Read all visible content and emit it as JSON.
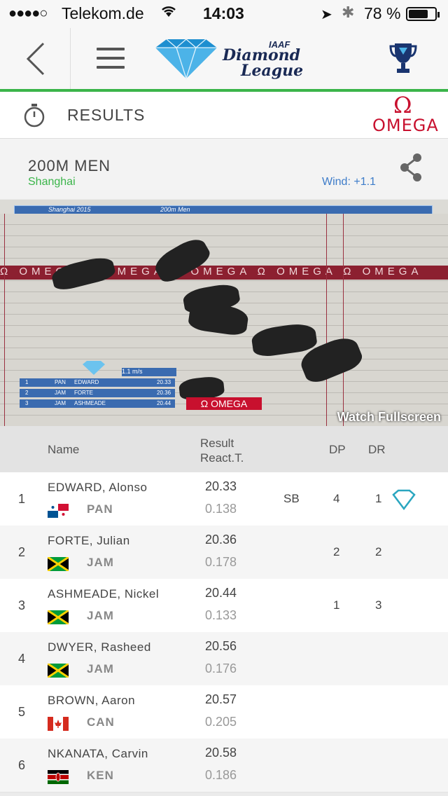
{
  "status": {
    "signal": "●●●●○",
    "carrier": "Telekom.de",
    "time": "14:03",
    "battery_pct": "78 %",
    "battery_level": 0.78
  },
  "nav": {
    "logo_iaaf": "IAAF",
    "logo_line1": "Diamond",
    "logo_line2": "League"
  },
  "section": {
    "title": "RESULTS",
    "sponsor_symbol": "Ω",
    "sponsor": "OMEGA"
  },
  "event": {
    "name": "200M MEN",
    "place": "Shanghai",
    "wind": "Wind: +1.1"
  },
  "photo": {
    "banner_left": "Shanghai 2015",
    "banner_right": "200m Men",
    "ad_text": "Ω OMEGA Ω OMEGA Ω OMEGA Ω OMEGA Ω OMEGA",
    "box_wind": "1.1 m/s",
    "box_rows": [
      {
        "pos": "1",
        "cc": "PAN",
        "name": "EDWARD",
        "time": "20.33"
      },
      {
        "pos": "2",
        "cc": "JAM",
        "name": "FORTE",
        "time": "20.36"
      },
      {
        "pos": "3",
        "cc": "JAM",
        "name": "ASHMEADE",
        "time": "20.44"
      }
    ],
    "omega_box": "Ω OMEGA",
    "watch": "Watch Fullscreen"
  },
  "table_head": {
    "name": "Name",
    "result": "Result",
    "react": "React.T.",
    "dp": "DP",
    "dr": "DR"
  },
  "rows": [
    {
      "rank": "1",
      "name": "EDWARD, Alonso",
      "cc": "PAN",
      "result": "20.33",
      "react": "0.138",
      "sb": "SB",
      "dp": "4",
      "dr": "1"
    },
    {
      "rank": "2",
      "name": "FORTE, Julian",
      "cc": "JAM",
      "result": "20.36",
      "react": "0.178",
      "sb": "",
      "dp": "2",
      "dr": "2"
    },
    {
      "rank": "3",
      "name": "ASHMEADE, Nickel",
      "cc": "JAM",
      "result": "20.44",
      "react": "0.133",
      "sb": "",
      "dp": "1",
      "dr": "3"
    },
    {
      "rank": "4",
      "name": "DWYER, Rasheed",
      "cc": "JAM",
      "result": "20.56",
      "react": "0.176",
      "sb": "",
      "dp": "",
      "dr": ""
    },
    {
      "rank": "5",
      "name": "BROWN, Aaron",
      "cc": "CAN",
      "result": "20.57",
      "react": "0.205",
      "sb": "",
      "dp": "",
      "dr": ""
    },
    {
      "rank": "6",
      "name": "NKANATA, Carvin",
      "cc": "KEN",
      "result": "20.58",
      "react": "0.186",
      "sb": "",
      "dp": "",
      "dr": ""
    }
  ],
  "colors": {
    "accent_green": "#3bb54a",
    "wind_blue": "#3d7cc9",
    "omega_red": "#c8102e",
    "diamond_teal": "#2aa6c0"
  }
}
